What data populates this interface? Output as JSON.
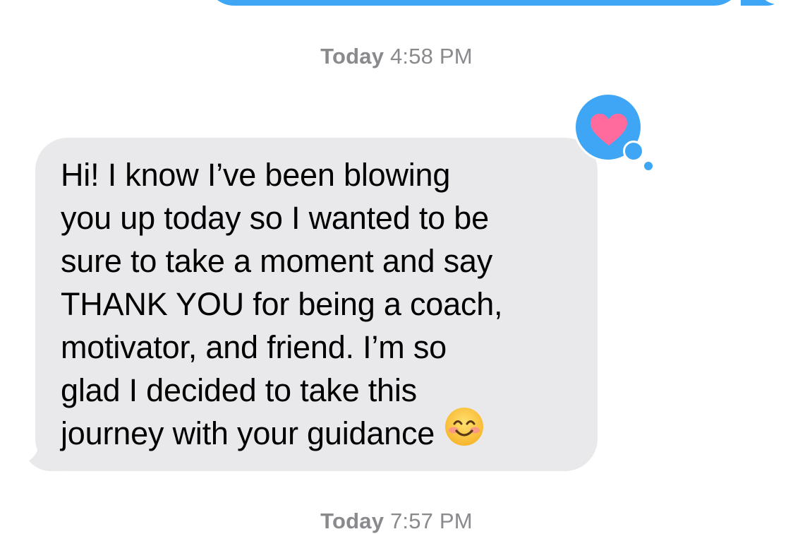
{
  "previous_message": {
    "type": "outgoing",
    "color": "#3ea6f5"
  },
  "timestamps": [
    {
      "day": "Today",
      "time": "4:58 PM"
    },
    {
      "day": "Today",
      "time": "7:57 PM"
    }
  ],
  "message": {
    "type": "incoming",
    "color": "#e9e9eb",
    "text": "Hi! I know I’ve been blowing\nyou up today so I wanted to be\nsure to take a moment and say\nTHANK YOU for being a coach,\nmotivator, and friend. I’m so\nglad I decided to take this\njourney with your guidance",
    "emoji": "smiling-face-emoji",
    "tapback": {
      "icon": "heart-icon",
      "bubble_color": "#3ea6f5",
      "heart_color": "#ff6b9d"
    }
  }
}
